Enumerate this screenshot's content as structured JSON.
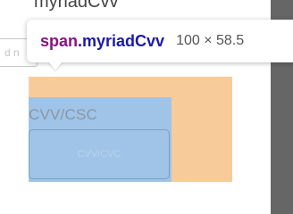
{
  "page": {
    "top_text": "myriadCvv"
  },
  "left_input": {
    "placeholder_fragment": "d n"
  },
  "tooltip": {
    "tag": "span",
    "class": ".myriadCvv",
    "dimensions": "100 × 58.5"
  },
  "field": {
    "label": "CVV/CSC",
    "placeholder": "CVV/CVC"
  },
  "colors": {
    "tag_color": "#881280",
    "class_color": "#1a1aa6",
    "padding_highlight": "#f7cc9a",
    "content_highlight": "#9fc4e8"
  }
}
